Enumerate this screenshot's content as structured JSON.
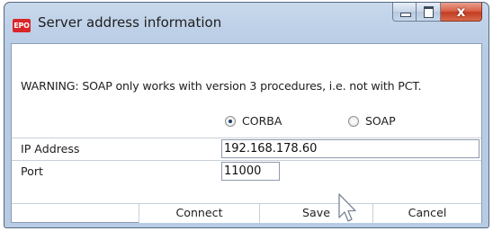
{
  "window": {
    "title": "Server address information",
    "app_icon_text": "EPO",
    "close_glyph": "x"
  },
  "warning": "WARNING: SOAP only works with version 3 procedures, i.e. not with PCT.",
  "protocol": {
    "options": [
      {
        "label": "CORBA",
        "selected": true
      },
      {
        "label": "SOAP",
        "selected": false
      }
    ]
  },
  "fields": {
    "ip_label": "IP Address",
    "ip_value": "192.168.178.60",
    "port_label": "Port",
    "port_value": "11000"
  },
  "buttons": {
    "connect": "Connect",
    "save": "Save",
    "cancel": "Cancel"
  },
  "colors": {
    "title_bar": "#bdd0e7",
    "close_button": "#c23c22",
    "app_icon": "#d8262a"
  }
}
